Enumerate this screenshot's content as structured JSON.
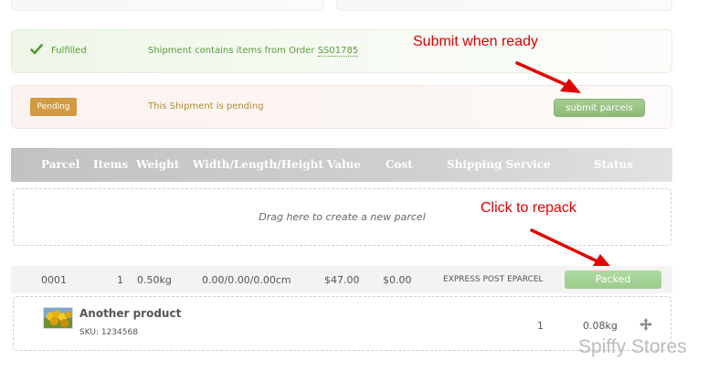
{
  "fulfilled_bar": {
    "status_label": "Fulfilled",
    "message": "Shipment contains items from Order ",
    "order_number": "SS01785",
    "color": "#5a9a3c"
  },
  "pending_bar": {
    "badge_label": "Pending",
    "message": "This Shipment is pending",
    "submit_label": "submit parcels",
    "badge_color": "#d39a41"
  },
  "annotations": {
    "submit_note": "Submit when ready",
    "repack_note": "Click to repack",
    "color": "#e00000"
  },
  "table": {
    "headers": [
      "Parcel",
      "Items",
      "Weight",
      "Width/Length/Height",
      "Value",
      "Cost",
      "Shipping Service",
      "Status"
    ],
    "dropzone_text": "Drag here to create a new parcel"
  },
  "parcel": {
    "number": "0001",
    "items": "1",
    "weight": "0.50kg",
    "dimensions": "0.00/0.00/0.00cm",
    "value": "$47.00",
    "cost": "$0.00",
    "service": "EXPRESS POST EPARCEL",
    "status": "Packed"
  },
  "item": {
    "name": "Another product",
    "sku": "SKU: 1234568",
    "quantity": "1",
    "weight": "0.08kg",
    "thumbnail_icon": "product-thumbnail",
    "drag_icon": "move-icon"
  },
  "watermark": "Spiffy Stores"
}
